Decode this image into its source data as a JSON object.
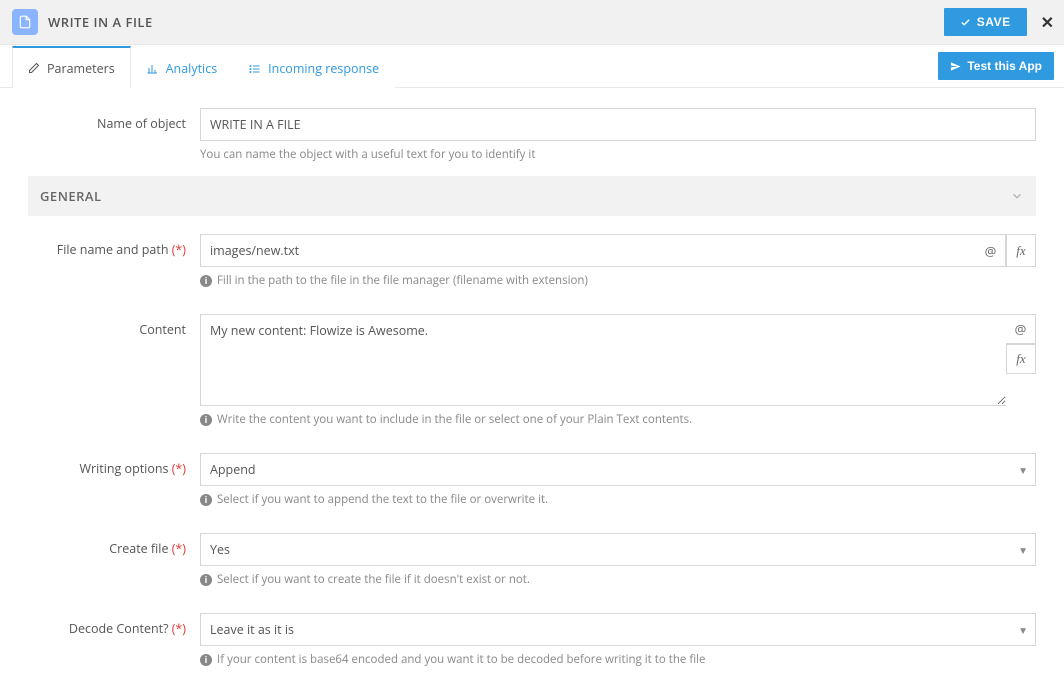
{
  "header": {
    "title": "WRITE IN A FILE",
    "save_label": "SAVE"
  },
  "tabs": {
    "parameters": "Parameters",
    "analytics": "Analytics",
    "incoming": "Incoming response",
    "test_app": "Test this App"
  },
  "section": {
    "general": "GENERAL"
  },
  "fields": {
    "name_label": "Name of object",
    "name_value": "WRITE IN A FILE",
    "name_help": "You can name the object with a useful text for you to identify it",
    "filepath_label": "File name and path",
    "filepath_value": "images/new.txt",
    "filepath_help": "Fill in the path to the file in the file manager (filename with extension)",
    "content_label": "Content",
    "content_value": "My new content: Flowize is Awesome.",
    "content_help": "Write the content you want to include in the file or select one of your Plain Text contents.",
    "writing_label": "Writing options",
    "writing_value": "Append",
    "writing_help": "Select if you want to append the text to the file or overwrite it.",
    "create_label": "Create file",
    "create_value": "Yes",
    "create_help": "Select if you want to create the file if it doesn't exist or not.",
    "decode_label": "Decode Content?",
    "decode_value": "Leave it as it is",
    "decode_help": "If your content is base64 encoded and you want it to be decoded before writing it to the file"
  },
  "marks": {
    "required": "(*)",
    "at": "@",
    "fx": "fx"
  }
}
